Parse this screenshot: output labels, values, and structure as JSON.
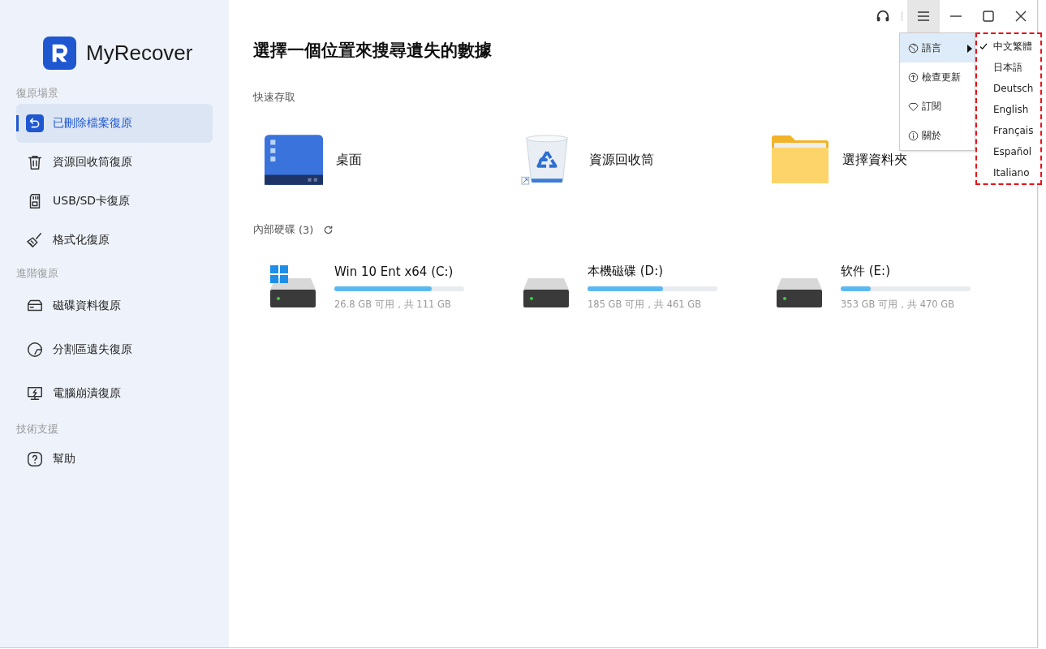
{
  "app": {
    "name": "MyRecover"
  },
  "sidebar": {
    "sections": [
      {
        "title": "復原場景",
        "items": [
          {
            "label": "已刪除檔案復原",
            "selected": true
          },
          {
            "label": "資源回收筒復原",
            "selected": false
          },
          {
            "label": "USB/SD卡復原",
            "selected": false
          },
          {
            "label": "格式化復原",
            "selected": false
          }
        ]
      },
      {
        "title": "進階復原",
        "items": [
          {
            "label": "磁碟資料復原",
            "selected": false
          },
          {
            "label": "分割區遺失復原",
            "selected": false
          },
          {
            "label": "電腦崩潰復原",
            "selected": false
          }
        ]
      },
      {
        "title": "技術支援",
        "items": [
          {
            "label": "幫助",
            "selected": false
          }
        ]
      }
    ]
  },
  "main": {
    "title": "選擇一個位置來搜尋遺失的數據",
    "quick_access": {
      "title": "快速存取",
      "items": [
        {
          "label": "桌面"
        },
        {
          "label": "資源回收筒"
        },
        {
          "label": "選擇資料夾"
        }
      ]
    },
    "internal_disks": {
      "title": "內部硬碟",
      "count": "(3)",
      "drives": [
        {
          "name": "Win 10 Ent x64 (C:)",
          "system": true,
          "level": 0.75,
          "usage": "26.8 GB 可用，共 111 GB"
        },
        {
          "name": "本機磁碟 (D:)",
          "system": false,
          "level": 0.58,
          "usage": "185 GB 可用，共 461 GB"
        },
        {
          "name": "软件 (E:)",
          "system": false,
          "level": 0.23,
          "usage": "353 GB 可用，共 470 GB"
        }
      ]
    }
  },
  "menu": {
    "items": [
      {
        "label": "語言",
        "expanded": true
      },
      {
        "label": "檢查更新",
        "expanded": false
      },
      {
        "label": "訂閱",
        "expanded": false
      },
      {
        "label": "關於",
        "expanded": false
      }
    ],
    "languages": [
      {
        "label": "中文繁體",
        "selected": true
      },
      {
        "label": "日本語",
        "selected": false
      },
      {
        "label": "Deutsch",
        "selected": false
      },
      {
        "label": "English",
        "selected": false
      },
      {
        "label": "Français",
        "selected": false
      },
      {
        "label": "Español",
        "selected": false
      },
      {
        "label": "Italiano",
        "selected": false
      }
    ]
  }
}
